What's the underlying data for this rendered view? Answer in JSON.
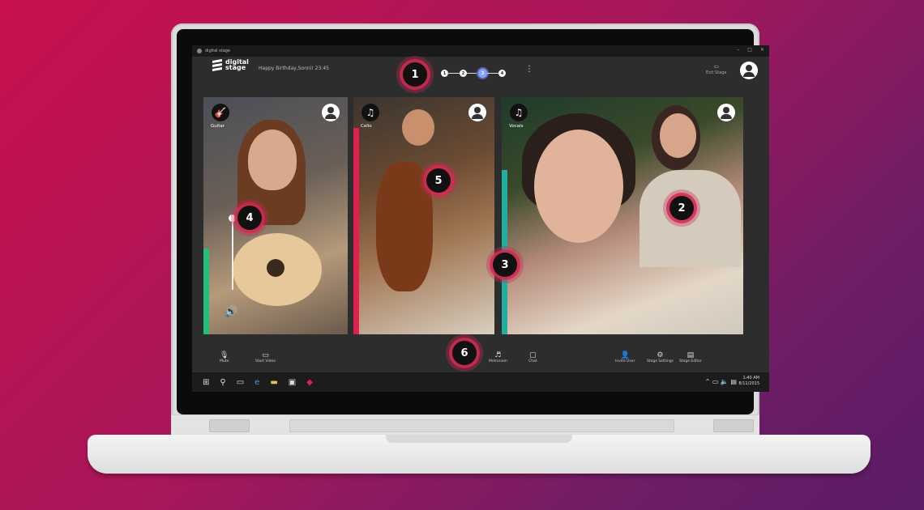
{
  "window": {
    "title": "digital stage",
    "controls": [
      "–",
      "□",
      "✕"
    ]
  },
  "header": {
    "logo_line1": "digital",
    "logo_line2": "stage",
    "stage_name": "Happy Birthday,Sonni! 23:45",
    "steps": [
      "1",
      "2",
      "3",
      "4"
    ],
    "active_step": 3,
    "more_glyph": "⋮",
    "exit_label": "Exit Stage",
    "exit_glyph": "⇦"
  },
  "tiles": [
    {
      "icon": "guitar-icon",
      "glyph": "🎸",
      "label": "Guitar",
      "level_color": "#22c07a"
    },
    {
      "icon": "music-note-icon",
      "glyph": "♫",
      "label": "Cello",
      "level_color": "#e0204e"
    },
    {
      "icon": "music-note-icon",
      "glyph": "♫",
      "label": "Vocals",
      "level_color": "#20b0a0"
    }
  ],
  "volume": {
    "glyph": "🔊",
    "level": 0.97
  },
  "toolbar": {
    "mute": "Mute",
    "start_video": "Start Video",
    "metronome": "Metronom",
    "chat": "Chat",
    "invite_user": "Invite User",
    "stage_settings": "Stage Settings",
    "stage_editor": "Stage Editor"
  },
  "taskbar": {
    "time": "1:40 AM",
    "date": "8/11/2015"
  },
  "markers": [
    "1",
    "2",
    "3",
    "4",
    "5",
    "6"
  ]
}
